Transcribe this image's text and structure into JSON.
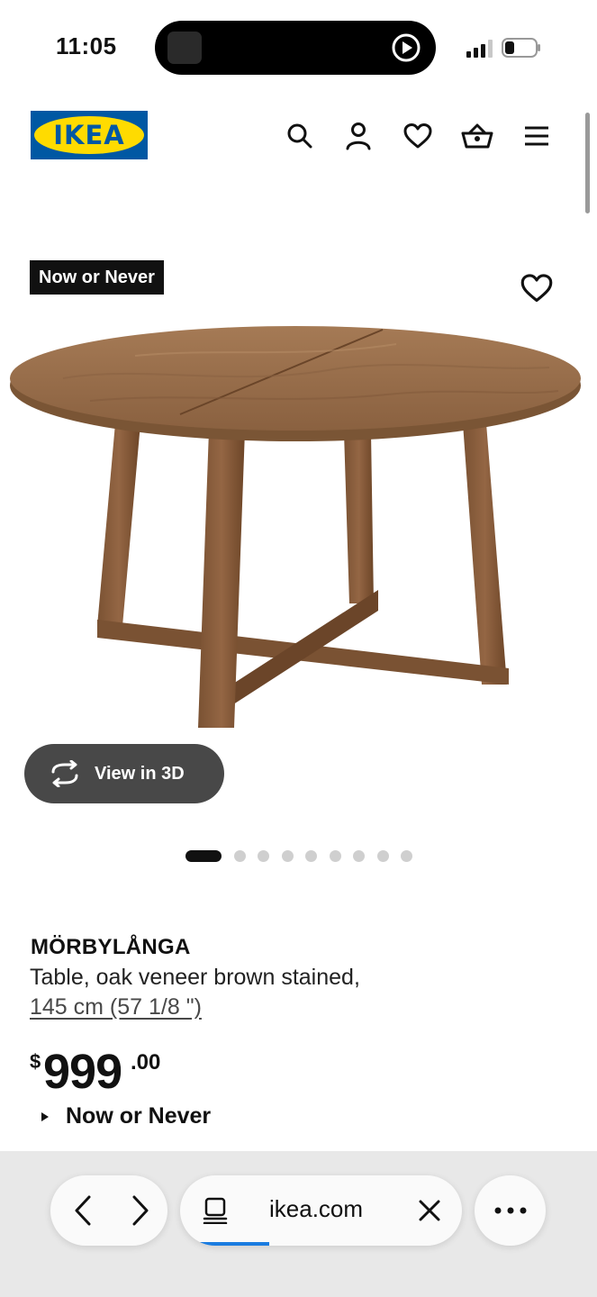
{
  "status_bar": {
    "time": "11:05"
  },
  "header": {
    "logo_text": "IKEA",
    "icons": [
      "search-icon",
      "account-icon",
      "heart-icon",
      "basket-icon",
      "menu-icon"
    ]
  },
  "product": {
    "badge": "Now or Never",
    "view_3d_label": "View in 3D",
    "carousel": {
      "total": 9,
      "active": 1
    },
    "name": "MÖRBYLÅNGA",
    "description": "Table, oak veneer brown stained,",
    "size": "145 cm (57 1/8 \")",
    "price": {
      "currency": "$",
      "integer": "999",
      "decimal": ".00"
    },
    "promo_label": "Now or Never"
  },
  "browser": {
    "url": "ikea.com",
    "load_progress_fraction": 0.25
  },
  "colors": {
    "ikea_blue": "#0058a3",
    "ikea_yellow": "#ffdb00",
    "badge_bg": "#111111",
    "button_3d_bg": "#484848",
    "progress": "#1a7ce0"
  }
}
